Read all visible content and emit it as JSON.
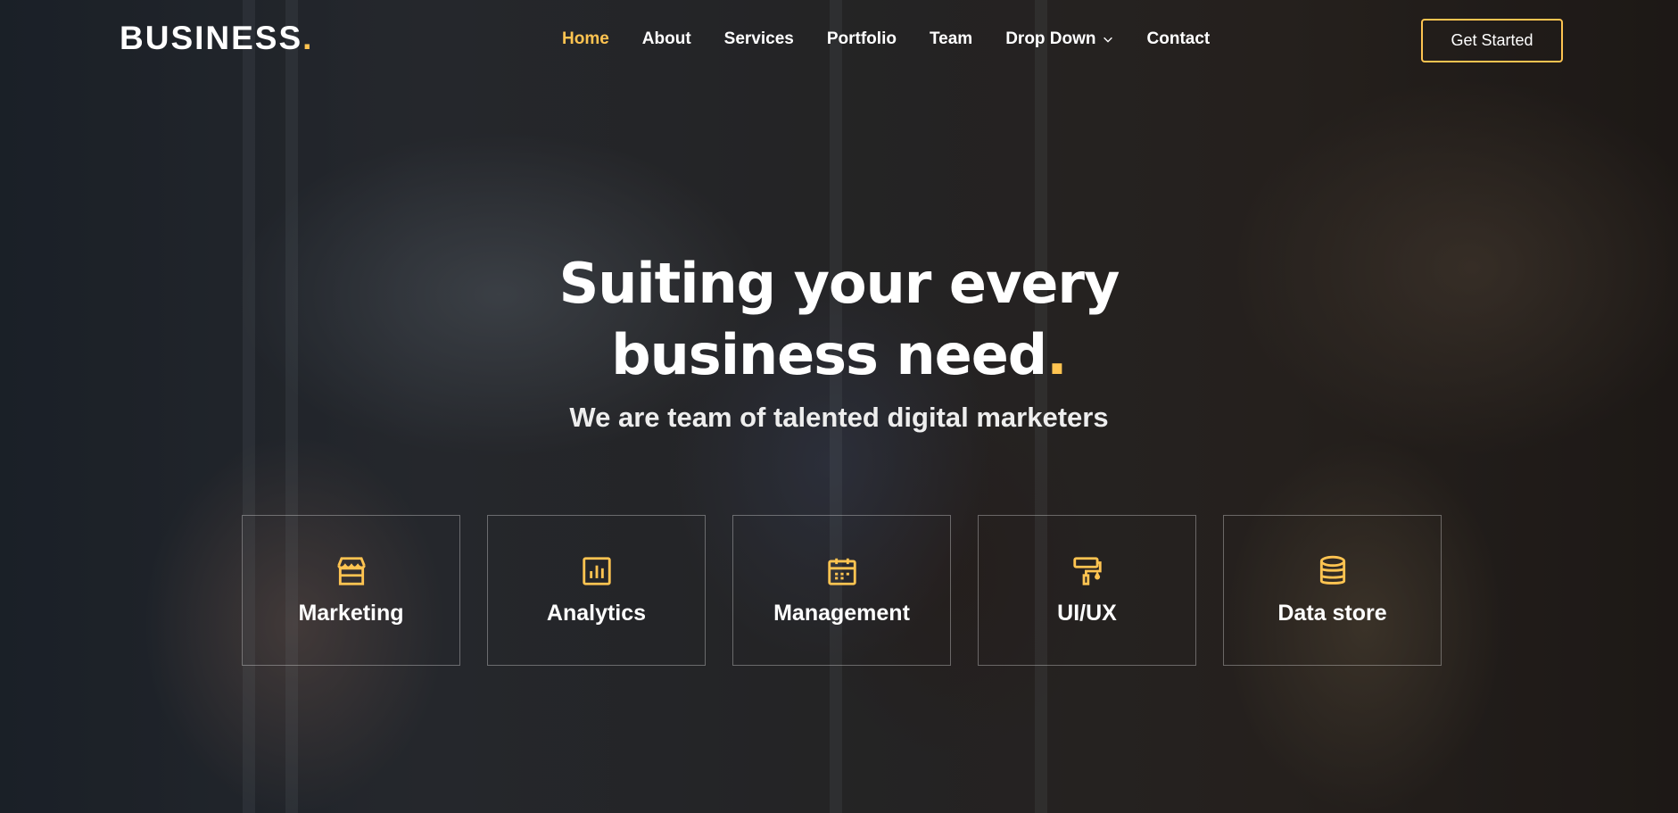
{
  "brand": {
    "name": "BUSINESS",
    "dot": ".",
    "accent_color": "#ffc451"
  },
  "nav": {
    "items": [
      {
        "label": "Home",
        "active": true
      },
      {
        "label": "About"
      },
      {
        "label": "Services"
      },
      {
        "label": "Portfolio"
      },
      {
        "label": "Team"
      },
      {
        "label": "Drop Down",
        "has_dropdown": true,
        "icon": "chevron-down-icon"
      },
      {
        "label": "Contact"
      }
    ]
  },
  "cta": {
    "label": "Get Started"
  },
  "hero": {
    "title_line1": "Suiting your every",
    "title_line2": "business need",
    "title_dot": ".",
    "subtitle": "We are team of talented digital marketers"
  },
  "features": [
    {
      "label": "Marketing",
      "icon": "store-icon"
    },
    {
      "label": "Analytics",
      "icon": "bar-chart-icon"
    },
    {
      "label": "Management",
      "icon": "calendar-icon"
    },
    {
      "label": "UI/UX",
      "icon": "paint-roller-icon"
    },
    {
      "label": "Data store",
      "icon": "database-icon"
    }
  ]
}
